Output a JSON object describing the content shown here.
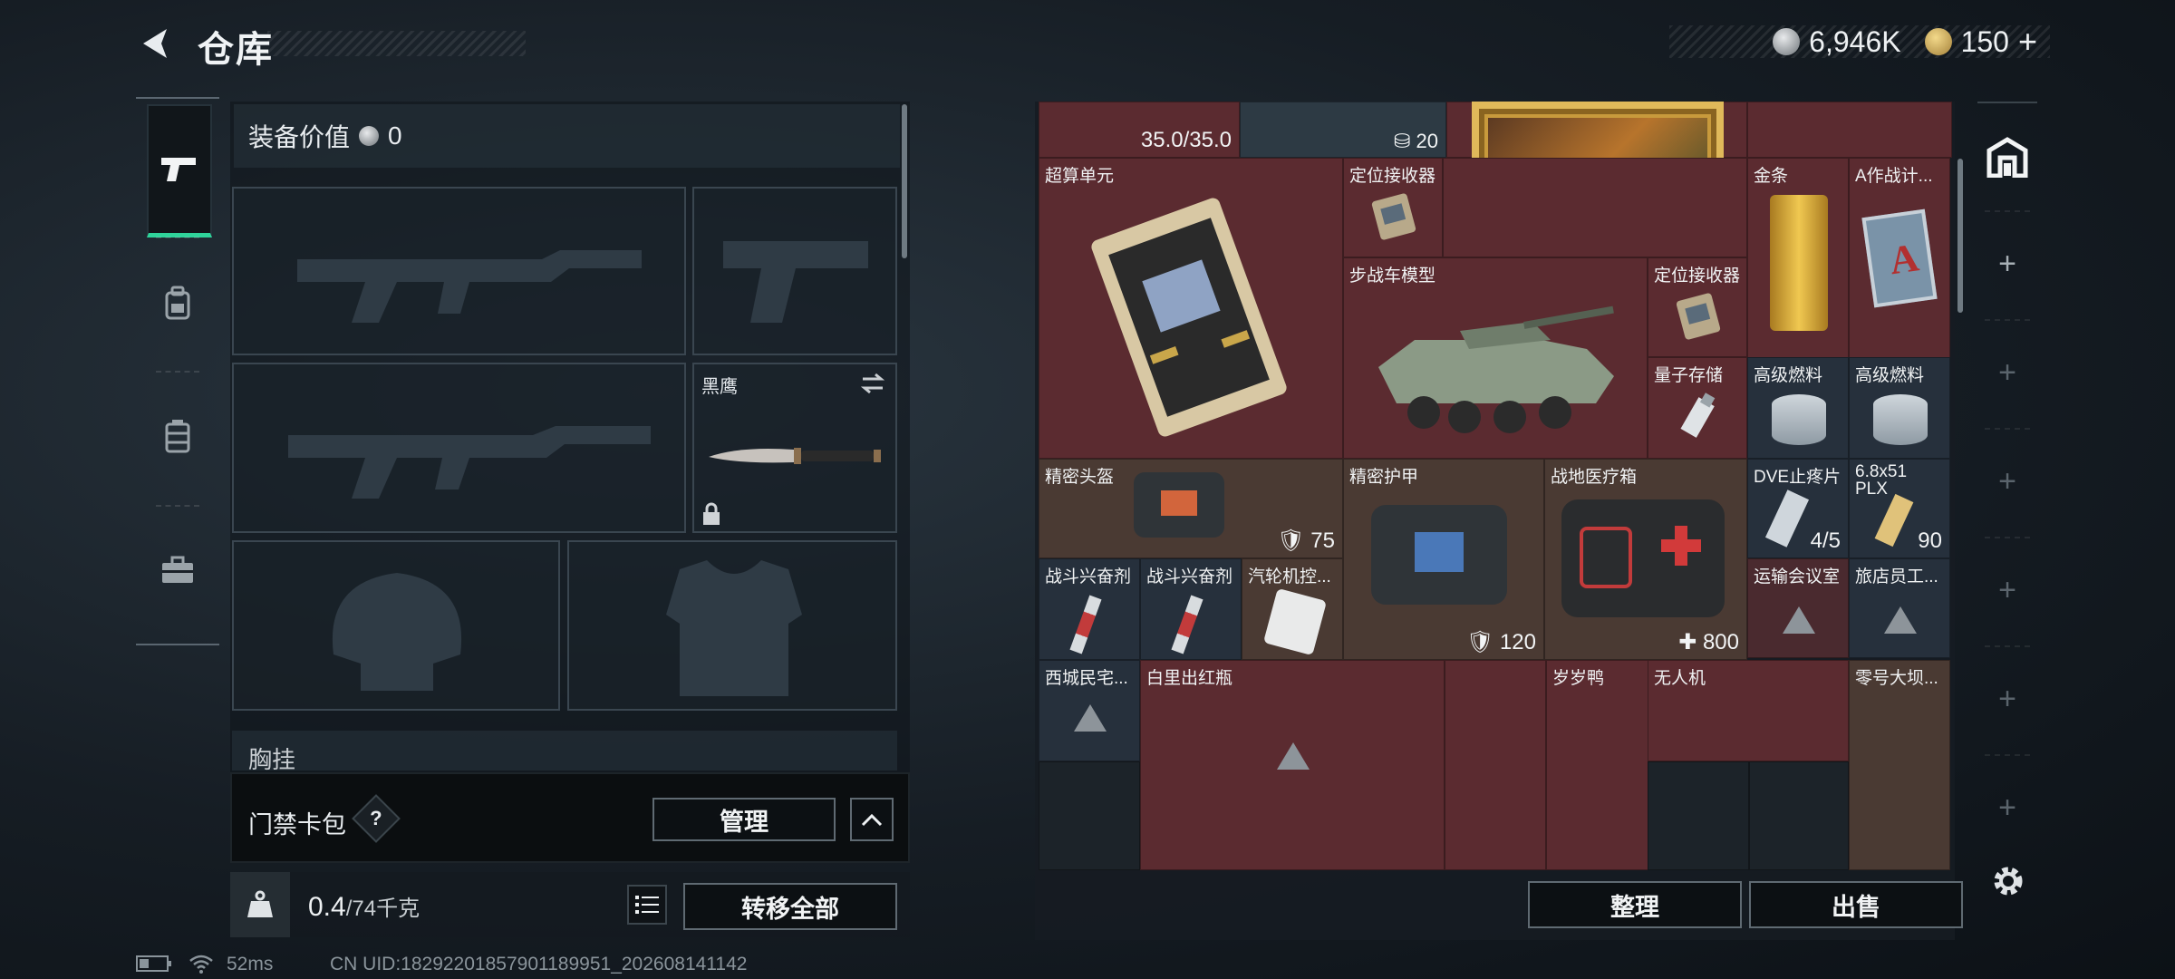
{
  "header": {
    "title": "仓库",
    "currency_main": "6,946K",
    "currency_premium": "150"
  },
  "equipment": {
    "value_label": "装备价值",
    "value": "0",
    "melee_name": "黑鹰",
    "chest_rig_label": "胸挂"
  },
  "gate_card": {
    "label": "门禁卡包",
    "manage": "管理"
  },
  "weight": {
    "value": "0.4",
    "capacity": "/74千克",
    "transfer_all": "转移全部"
  },
  "inventory": {
    "items": [
      {
        "name": "超算单元"
      },
      {
        "name": "定位接收器"
      },
      {
        "name": "金条"
      },
      {
        "name": "A作战计..."
      },
      {
        "name": "步战车模型"
      },
      {
        "name": "定位接收器"
      },
      {
        "name": "量子存储"
      },
      {
        "name": "高级燃料"
      },
      {
        "name": "高级燃料"
      },
      {
        "name": "精密头盔",
        "value": "75"
      },
      {
        "name": "精密护甲",
        "value": "120"
      },
      {
        "name": "战地医疗箱",
        "value": "800"
      },
      {
        "name": "DVE止疼片",
        "value": "4/5"
      },
      {
        "name": "6.8x51 PLX",
        "value": "90"
      },
      {
        "name": "战斗兴奋剂"
      },
      {
        "name": "战斗兴奋剂"
      },
      {
        "name": "汽轮机控..."
      },
      {
        "name": "运输会议室"
      },
      {
        "name": "旅店员工..."
      },
      {
        "name": "西城民宅..."
      },
      {
        "name": "白里出红瓶"
      },
      {
        "name": "岁岁鸭"
      },
      {
        "name": "无人机"
      },
      {
        "name": "零号大坝..."
      }
    ],
    "top_values": [
      "35.0/35.0",
      "20"
    ],
    "sort_button": "整理",
    "sell_button": "出售"
  },
  "status": {
    "ping": "52ms",
    "uid": "CN UID:18292201857901189951_202608141142"
  },
  "colors": {
    "accent_green": "#2fd39a",
    "cell_red": "#5b2b30",
    "cell_brown": "#4a3a33",
    "cell_teal": "#2d3a44"
  }
}
